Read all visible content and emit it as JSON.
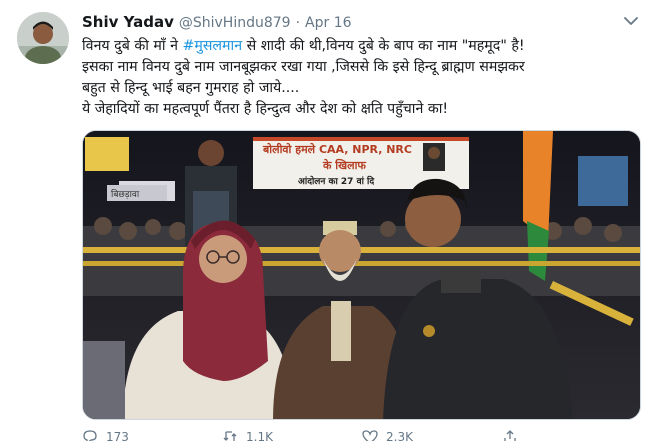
{
  "tweet": {
    "author_name": "Shiv Yadav",
    "author_handle": "@ShivHindu879",
    "separator": "·",
    "date": "Apr 16",
    "lines": [
      {
        "before": "विनय दुबे की माँ ने ",
        "hashtag": "#मुसलमान",
        "after": " से शादी की थी,विनय दुबे के बाप का नाम \"महमूद\" है!"
      },
      {
        "text": "इसका नाम विनय दुबे नाम जानबूझकर रखा गया ,जिससे कि इसे हिन्दू ब्राह्मण समझकर"
      },
      {
        "text": "बहुत से हिन्दू भाई बहन गुमराह हो जाये...."
      },
      {
        "text": "ये जेहादियों का महत्वपूर्ण पैंतरा है हिन्दुत्व और देश को क्षति पहुँचाने का!"
      }
    ],
    "media": {
      "banner_line1": "बोलीवो हमले CAA, NPR, NRC",
      "banner_line2": "के खिलाफ",
      "banner_line3": "आंदोलन का 27 वां दि",
      "side_sign": "बिछड़ावा"
    },
    "actions": {
      "reply_count": "173",
      "retweet_count": "1.1K",
      "like_count": "2.3K"
    }
  },
  "icons": {
    "chevron": "chevron-down-icon",
    "reply": "reply-icon",
    "retweet": "retweet-icon",
    "like": "heart-icon",
    "share": "share-icon"
  },
  "colors": {
    "hashtag": "#1b95e0",
    "secondary_text": "#657786",
    "primary_text": "#14171a"
  }
}
